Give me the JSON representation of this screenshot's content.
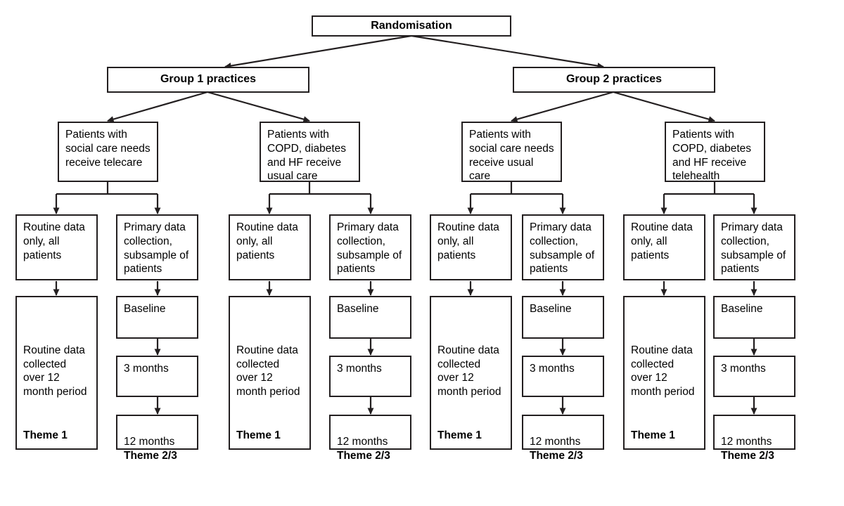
{
  "diagram": {
    "type": "flowchart",
    "title_node": {
      "label": "Randomisation"
    },
    "level2": [
      {
        "label": "Group 1 practices"
      },
      {
        "label": "Group 2 practices"
      }
    ],
    "level3": [
      {
        "label": "Patients with social care needs receive telecare"
      },
      {
        "label": "Patients with COPD, diabetes and HF receive usual care"
      },
      {
        "label": "Patients with social care needs receive usual care"
      },
      {
        "label": "Patients with COPD, diabetes and HF receive telehealth"
      }
    ],
    "level4": [
      {
        "label": "Routine data only, all patients"
      },
      {
        "label": "Primary data collection, subsample of patients"
      },
      {
        "label": "Routine data only, all patients"
      },
      {
        "label": "Primary data collection, subsample of patients"
      },
      {
        "label": "Routine data only, all patients"
      },
      {
        "label": "Primary data collection, subsample of patients"
      },
      {
        "label": "Routine data only, all patients"
      },
      {
        "label": "Primary data collection, subsample of patients"
      }
    ],
    "routine_column": {
      "label": "Routine data collected over 12 month period",
      "theme": "Theme 1"
    },
    "primary_column": {
      "baseline": "Baseline",
      "three_months": "3 months",
      "twelve_months": "12 months",
      "theme": "Theme 2/3"
    },
    "colors": {
      "stroke": "#231f20",
      "background": "#ffffff",
      "text": "#000000"
    }
  }
}
